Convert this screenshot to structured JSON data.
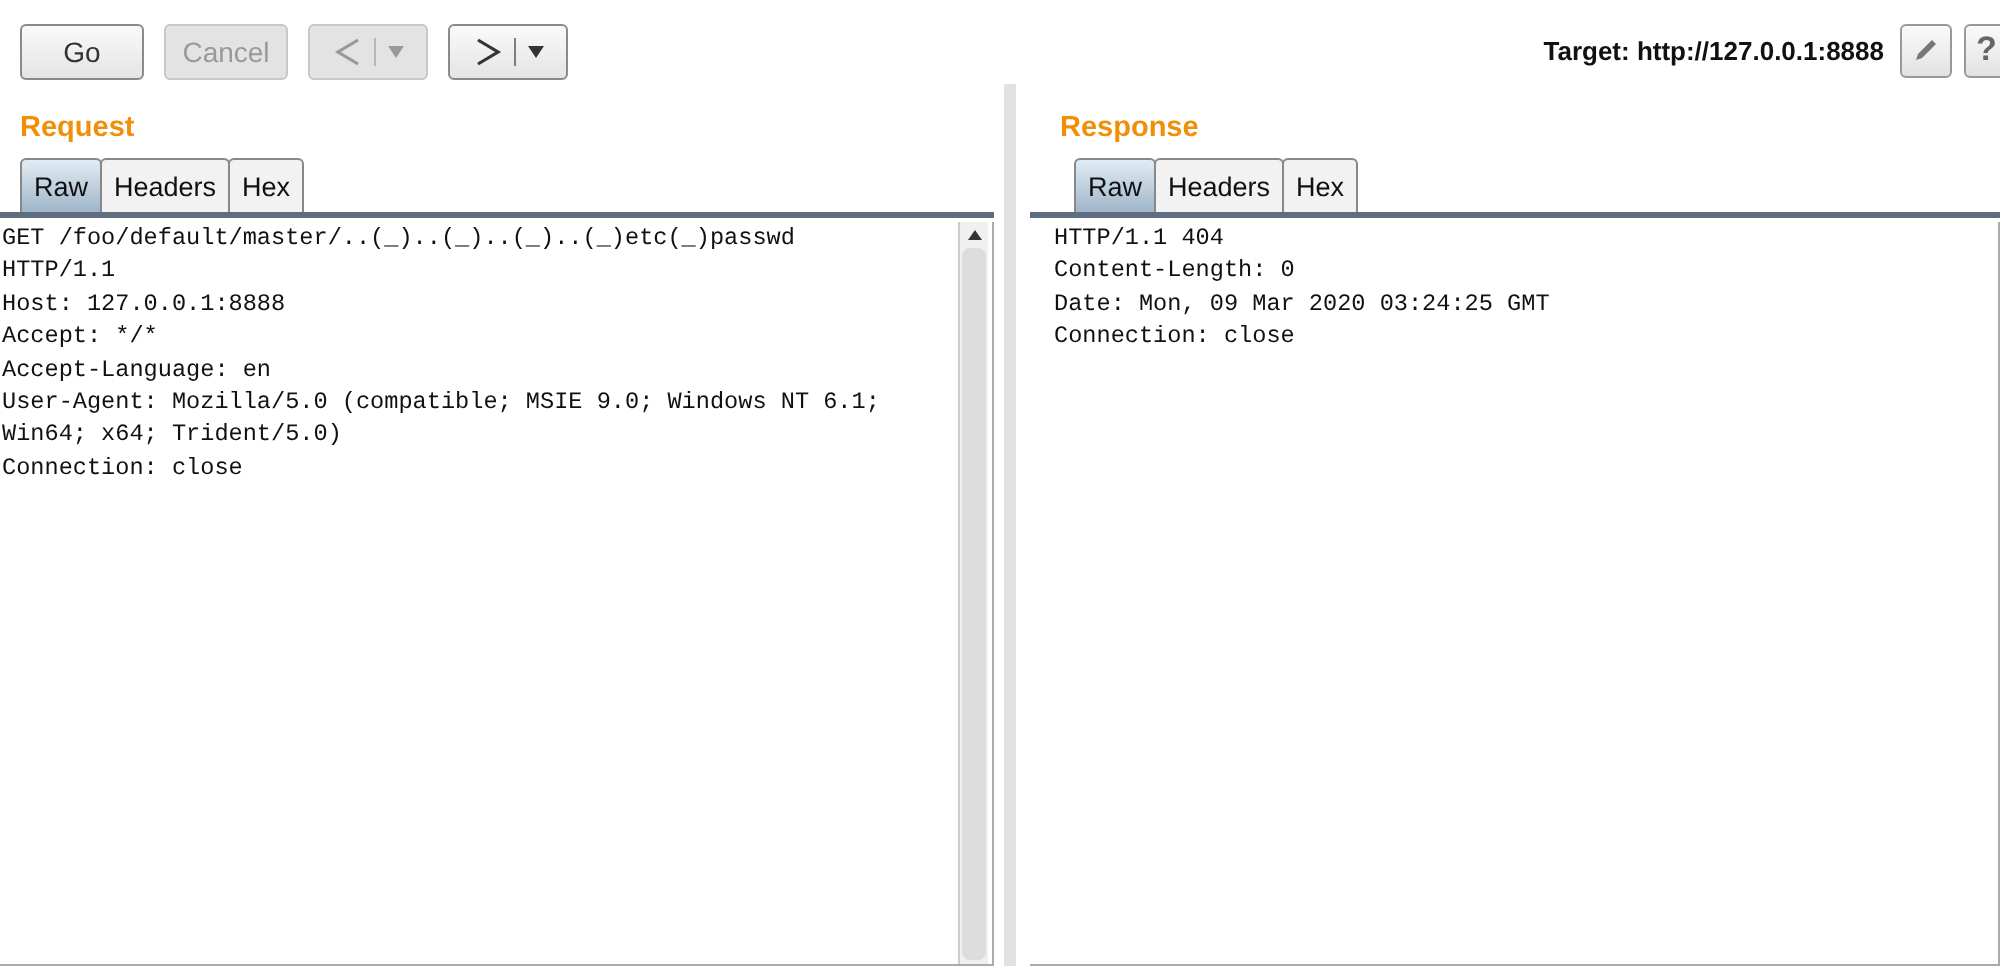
{
  "toolbar": {
    "buttons": [
      {
        "kind": "text",
        "label": "Go",
        "disabled": false
      },
      {
        "kind": "text",
        "label": "Cancel",
        "disabled": true
      },
      {
        "kind": "back",
        "disabled": true
      },
      {
        "kind": "forward",
        "disabled": false
      }
    ],
    "target": "Target: http://127.0.0.1:8888",
    "help": "?"
  },
  "panels": [
    {
      "title": "Request",
      "tabs": [
        {
          "label": "Raw",
          "selected": true
        },
        {
          "label": "Headers",
          "selected": false
        },
        {
          "label": "Hex",
          "selected": false
        }
      ],
      "lines": [
        "GET /foo/default/master/..(_)..(_)..(_)..(_)etc(_)passwd",
        "HTTP/1.1",
        "Host: 127.0.0.1:8888",
        "Accept: */*",
        "Accept-Language: en",
        "User-Agent: Mozilla/5.0 (compatible; MSIE 9.0; Windows NT 6.1;",
        "Win64; x64; Trident/5.0)",
        "Connection: close"
      ]
    },
    {
      "title": "Response",
      "tabs": [
        {
          "label": "Raw",
          "selected": true
        },
        {
          "label": "Headers",
          "selected": false
        },
        {
          "label": "Hex",
          "selected": false
        }
      ],
      "lines": [
        "HTTP/1.1 404",
        "Content-Length: 0",
        "Date: Mon, 09 Mar 2020 03:24:25 GMT",
        "Connection: close"
      ]
    }
  ]
}
